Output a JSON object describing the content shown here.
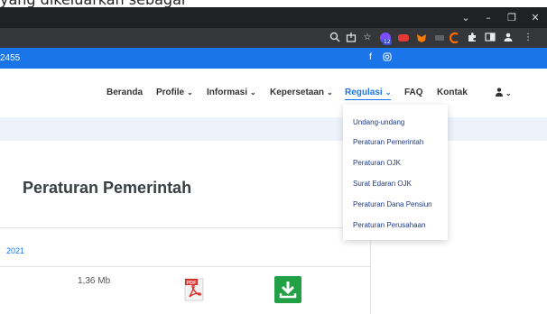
{
  "page_header_sliver": "yang dikeluarkan sebagai",
  "browser": {
    "window_controls": {
      "minimize": "–",
      "restore": "❐",
      "close": "✕",
      "dropdown": "⌄"
    },
    "extension_badge": "12"
  },
  "topbar": {
    "phone_fragment": "2455"
  },
  "nav": {
    "items": [
      {
        "label": "Beranda",
        "has_caret": false
      },
      {
        "label": "Profile",
        "has_caret": true
      },
      {
        "label": "Informasi",
        "has_caret": true
      },
      {
        "label": "Kepersetaan",
        "has_caret": true
      },
      {
        "label": "Regulasi",
        "has_caret": true,
        "active": true
      },
      {
        "label": "FAQ",
        "has_caret": false
      },
      {
        "label": "Kontak",
        "has_caret": false
      }
    ],
    "user_icon": "user-icon"
  },
  "dropdown": {
    "items": [
      "Undang-undang",
      "Peraturan Pemerintah",
      "Peraturan OJK",
      "Surat Edaran OJK",
      "Peraturan Dana Pensiun",
      "Peraturan Perusahaan"
    ]
  },
  "content": {
    "title": "Peraturan Pemerintah",
    "year_fragment": "2021",
    "file_size": "1,36 Mb",
    "pdf_label": "PDF"
  },
  "colors": {
    "brand_blue": "#1a75e8",
    "download_green": "#22a045",
    "pdf_red": "#d9302b"
  }
}
